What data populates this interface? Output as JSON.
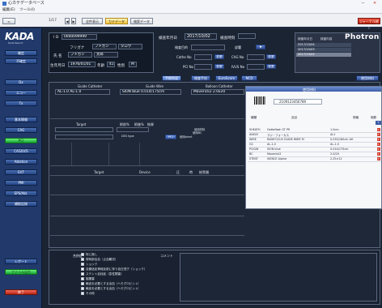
{
  "window": {
    "title": "心カテデータベース",
    "menu": [
      "編集(E)",
      "ツール(I)"
    ]
  },
  "toolbar": {
    "page_indicator": "1/17",
    "buttons": [
      "全件表示",
      "カテデータ",
      "検索データ"
    ],
    "exit_label": "ジャーナル終了"
  },
  "sidebar": {
    "logo": "KADA",
    "logo_sub": "Kada Report",
    "items": [
      "確定",
      "不確定",
      "Dx",
      "エコー",
      "Tx",
      "基本情報",
      "CAG",
      "PCI",
      "CAG/LVG",
      "Ablation",
      "EVT",
      "PMI",
      "EPS/Abl.",
      "補助記録"
    ],
    "bottom_items": [
      "レポート",
      "ファイル出力",
      "終了"
    ]
  },
  "patient": {
    "id": "0000099999",
    "id_prefix": "I D",
    "kana_label": "フリガナ",
    "kana_last": "フトガン",
    "kana_first": "タロウ",
    "name_label": "氏 名",
    "name_last": "フトガン",
    "name_first": "太郎",
    "dob_label": "生年月日",
    "dob": "1976/01/01",
    "age_label": "年齢",
    "age": "41",
    "sex_label": "性別",
    "sex": "M"
  },
  "exam": {
    "date_label": "検査年月日",
    "date": "2017/10/02",
    "time_label": "検査時刻",
    "purpose_label": "検査目的",
    "purpose_value": "",
    "dept_label": "部署",
    "cathe_label": "Cathe No",
    "cag_label": "CAG No",
    "pci_label": "PCI No",
    "ivus_label": "IVUS No",
    "edit_label": "変更"
  },
  "history": {
    "col1": "検査年月日",
    "col2": "検査内容",
    "rows": [
      "2017/10/04",
      "2017/10/03",
      "2017/10/02"
    ],
    "brand": "Photron"
  },
  "tabs": [
    "手術所見",
    "検査手技",
    "EuroScore",
    "NCD",
    "使用材料"
  ],
  "device_header": {
    "guide_catheter": "Guide Catheter",
    "guide_wire": "Guide Wire",
    "balloon_catheter": "Balloon Catheter"
  },
  "device_row": {
    "guide_catheter": "AL-1.0 AL-1.0",
    "guide_wire": "SION blue 0.014/175cm",
    "balloon_catheter": "Maverick2 2.0x20"
  },
  "target_header": {
    "target": "Target",
    "pre": "術前%",
    "post": "術後%",
    "result": "結果"
  },
  "target_row": {
    "stent_label": "DES type",
    "pci_btn": "PCI",
    "material_label": "使用材料",
    "used_label": "使用stent",
    "material2": "使用BC"
  },
  "second_header": {
    "target": "Target",
    "device": "Device",
    "c1": "圧",
    "c2": "時",
    "c3": "結等類"
  },
  "comments": {
    "label_left": "合併症",
    "label_right": "コメント",
    "options": [
      "特に無し",
      "穿刺部出血（止血難渋）",
      "ショック",
      "血管迷走神経反射に伴う血圧低下（ショック）",
      "ステント血栓症（急性閉塞）",
      "脳梗塞",
      "輸血を必要とする出血（ヘモグロビン↓）",
      "輸血を必要とする出血（ヘモグロビン↓）",
      "その他"
    ]
  },
  "popup": {
    "title": "使用材料",
    "barcode_value": "2109123456789",
    "col_type": "種類",
    "col_item": "品目",
    "col_spec": "規格",
    "col_count": "個数",
    "rows": [
      {
        "type": "SHEATH",
        "item": "Gettaflash ST Pfl",
        "spec": "1.0cm"
      },
      {
        "type": "ANGIO",
        "item": "ラジ・フォーカス",
        "spec": "AL1"
      },
      {
        "type": "WIRE",
        "item": "RADIFOCUS GUIDE WIRE M",
        "spec": "0.035/180cm AH"
      },
      {
        "type": "GC",
        "item": "AL-1.0",
        "spec": "AL-1.0"
      },
      {
        "type": "PCIGW",
        "item": "SION blue",
        "spec": "0.014/175cm"
      },
      {
        "type": "BC",
        "item": "Maverick2",
        "spec": "2.0/20"
      },
      {
        "type": "STENT",
        "item": "XIENCE Alpine",
        "spec": "2.25×12"
      }
    ]
  },
  "colors": {
    "accent": "#3b5ea6",
    "selected_green": "#17a233",
    "danger": "#b8241a",
    "panel": "#121a27"
  }
}
